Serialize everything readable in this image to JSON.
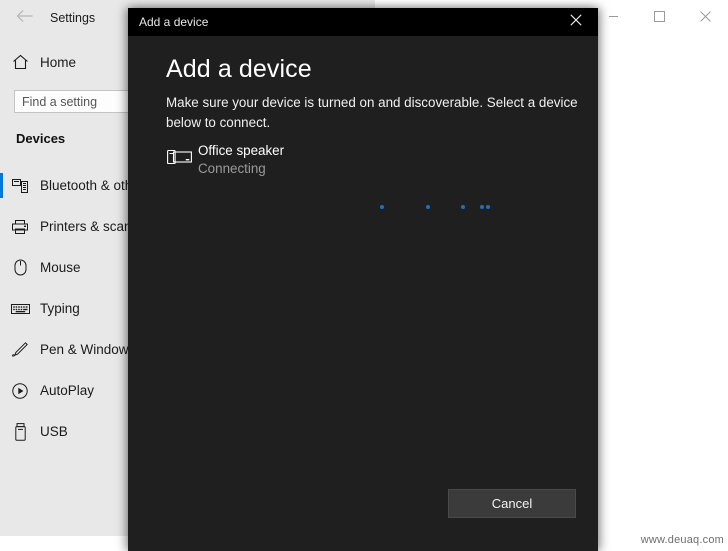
{
  "settings_window": {
    "title": "Settings",
    "back_icon": "back-arrow-icon",
    "window_controls": [
      {
        "name": "minimize",
        "icon": "minimize-icon"
      },
      {
        "name": "maximize",
        "icon": "maximize-icon"
      },
      {
        "name": "close",
        "icon": "close-icon"
      }
    ],
    "home": {
      "label": "Home",
      "icon": "home-icon"
    },
    "search": {
      "placeholder": "Find a setting",
      "value": ""
    },
    "section_header": "Devices",
    "nav_items": [
      {
        "label": "Bluetooth & other devices",
        "icon": "bluetooth-devices-icon",
        "selected": true
      },
      {
        "label": "Printers & scanners",
        "icon": "printer-icon",
        "selected": false
      },
      {
        "label": "Mouse",
        "icon": "mouse-icon",
        "selected": false
      },
      {
        "label": "Typing",
        "icon": "keyboard-icon",
        "selected": false
      },
      {
        "label": "Pen & Windows Ink",
        "icon": "pen-icon",
        "selected": false
      },
      {
        "label": "AutoPlay",
        "icon": "autoplay-icon",
        "selected": false
      },
      {
        "label": "USB",
        "icon": "usb-icon",
        "selected": false
      }
    ]
  },
  "dialog": {
    "titlebar_title": "Add a device",
    "close_icon": "close-icon",
    "heading": "Add a device",
    "description": "Make sure your device is turned on and discoverable. Select a device below to connect.",
    "device": {
      "icon": "device-speaker-icon",
      "name": "Office speaker",
      "status": "Connecting"
    },
    "progress": {
      "dot_color": "#1d6fc0",
      "dots": [
        124,
        170,
        205,
        224,
        230
      ]
    },
    "cancel_label": "Cancel"
  },
  "watermark": "www.deuaq.com",
  "colors": {
    "accent": "#0078d7",
    "dialog_body": "#1f1f1f",
    "dialog_titlebar": "#000000",
    "sidebar": "#e8e8e8",
    "window": "#ffffff"
  }
}
